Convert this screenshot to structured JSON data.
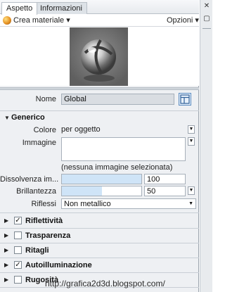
{
  "tabs": [
    {
      "label": "Aspetto",
      "active": true
    },
    {
      "label": "Informazioni",
      "active": false
    }
  ],
  "toolbar": {
    "create_material": "Crea materiale",
    "options": "Opzioni",
    "dropdown_glyph": "▾"
  },
  "right_strip": {
    "pin": "▢",
    "close": "✕"
  },
  "name": {
    "label": "Nome",
    "value": "Global"
  },
  "generic": {
    "title": "Generico",
    "color": {
      "label": "Colore",
      "value": "per oggetto"
    },
    "image": {
      "label": "Immagine",
      "note": "(nessuna immagine selezionata)"
    },
    "image_fade": {
      "label": "Dissolvenza im...",
      "value": "100",
      "fill": 1.0
    },
    "glossiness": {
      "label": "Brillantezza",
      "value": "50",
      "fill": 0.5
    },
    "highlights": {
      "label": "Riflessi",
      "value": "Non metallico"
    }
  },
  "sections": [
    {
      "label": "Riflettività",
      "checked": true
    },
    {
      "label": "Trasparenza",
      "checked": false
    },
    {
      "label": "Ritagli",
      "checked": false
    },
    {
      "label": "Autoilluminazione",
      "checked": true
    },
    {
      "label": "Rugosità",
      "checked": false
    }
  ],
  "watermark": "http://grafica2d3d.blogspot.com/",
  "colors": {
    "accent": "#cfe4f7",
    "panel": "#eef0f3",
    "preview_bg": "#6f6f6f"
  }
}
